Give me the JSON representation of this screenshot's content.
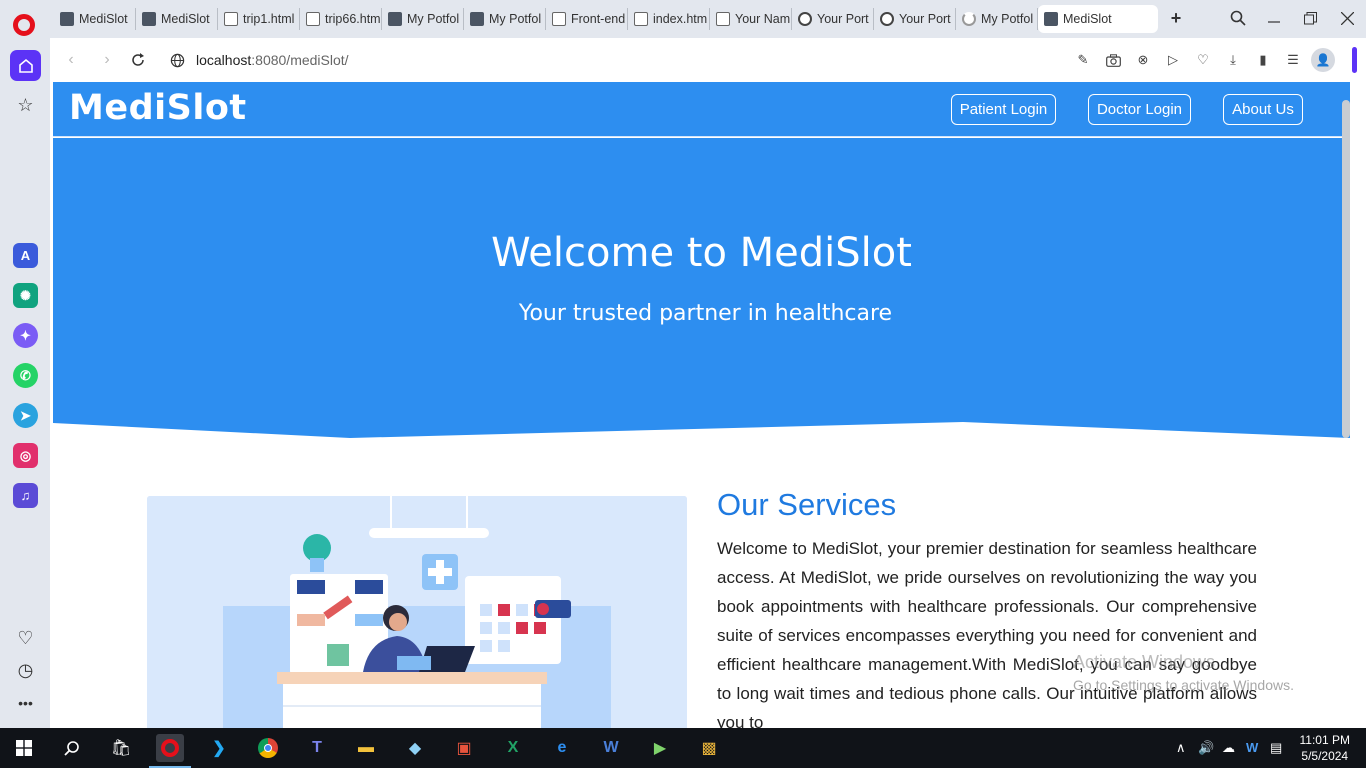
{
  "browser": {
    "tabs": [
      {
        "label": "MediSlot",
        "icon": "app-icon"
      },
      {
        "label": "MediSlot",
        "icon": "app-icon"
      },
      {
        "label": "trip1.html",
        "icon": "document-icon"
      },
      {
        "label": "trip66.htm",
        "icon": "document-icon"
      },
      {
        "label": "My Potfol",
        "icon": "app-icon"
      },
      {
        "label": "My Potfol",
        "icon": "app-icon"
      },
      {
        "label": "Front-end",
        "icon": "document-icon"
      },
      {
        "label": "index.htm",
        "icon": "document-icon"
      },
      {
        "label": "Your Nam",
        "icon": "document-icon"
      },
      {
        "label": "Your Port",
        "icon": "globe-icon"
      },
      {
        "label": "Your Port",
        "icon": "globe-icon"
      },
      {
        "label": "My Potfol",
        "icon": "loading-icon"
      },
      {
        "label": "MediSlot",
        "icon": "app-icon"
      }
    ],
    "new_tab": "+",
    "url_host": "localhost",
    "url_rest": ":8080/mediSlot/"
  },
  "site": {
    "brand": "MediSlot",
    "nav": {
      "patient_login": "Patient Login",
      "doctor_login": "Doctor Login",
      "about_us": "About Us"
    },
    "hero": {
      "title": "Welcome to MediSlot",
      "subtitle": "Your trusted partner in healthcare"
    },
    "services": {
      "title": "Our Services",
      "text": "Welcome to MediSlot, your premier destination for seamless healthcare access. At MediSlot, we pride ourselves on revolutionizing the way you book appointments with healthcare professionals. Our comprehensive suite of services encompasses everything you need for convenient and efficient healthcare management.With MediSlot, you can say goodbye to long wait times and tedious phone calls. Our intuitive platform allows you to"
    }
  },
  "watermark": {
    "line1": "Activate Windows",
    "line2": "Go to Settings to activate Windows."
  },
  "taskbar": {
    "time": "11:01 PM",
    "date": "5/5/2024"
  },
  "colors": {
    "brand_blue": "#2d8ef0",
    "heading_blue": "#1f7ae0",
    "opera_purple": "#5c33f6"
  }
}
